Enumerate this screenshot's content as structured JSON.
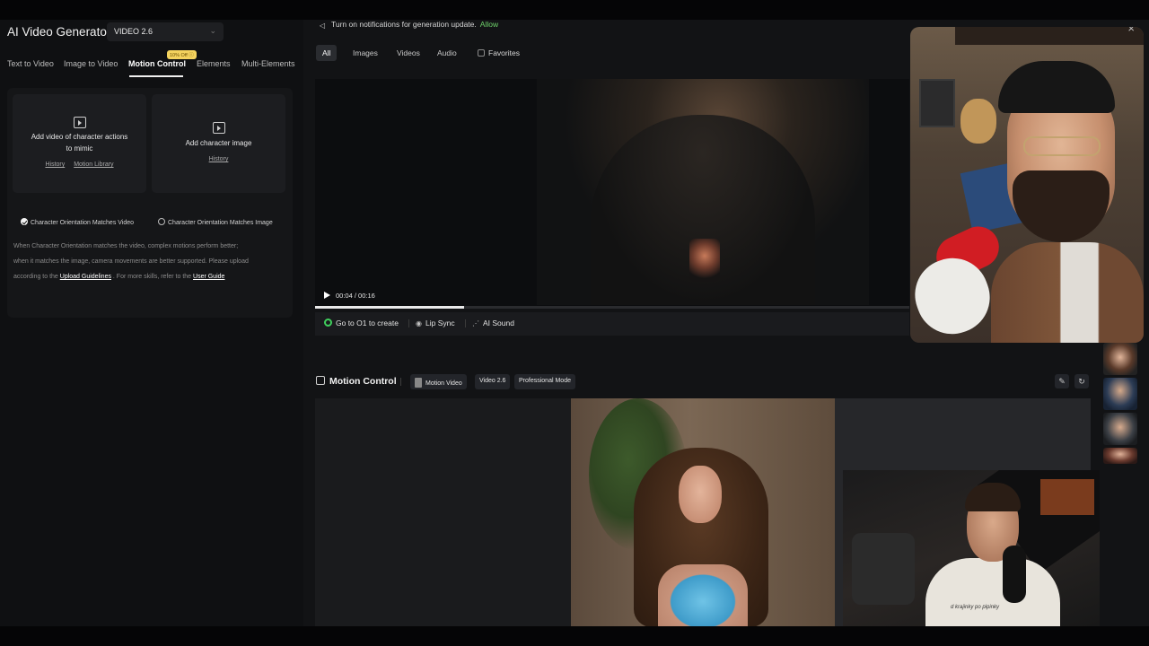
{
  "app": {
    "title": "AI Video Generator",
    "model_select": "VIDEO 2.6"
  },
  "tabs": [
    {
      "label": "Text to Video"
    },
    {
      "label": "Image to Video"
    },
    {
      "label": "Motion Control"
    },
    {
      "label": "Elements"
    },
    {
      "label": "Multi-Elements"
    }
  ],
  "promo_badge": "10% Off ⓘ",
  "upload": {
    "video_card": {
      "title_line1": "Add video of character actions",
      "title_line2": "to mimic",
      "link_history": "History",
      "link_library": "Motion Library"
    },
    "image_card": {
      "title": "Add character image",
      "link_history": "History"
    },
    "orientation_video": "Character Orientation Matches Video",
    "orientation_image": "Character Orientation Matches Image",
    "help_line1": "When Character Orientation matches the video, complex motions perform better;",
    "help_line2": "when it matches the image, camera movements are better supported. Please upload",
    "help_prefix": "according to the",
    "help_link1": "Upload Guidelines",
    "help_middle": ". For more skills, refer to the",
    "help_link2": "User Guide"
  },
  "notification": {
    "text": "Turn on notifications for generation update.",
    "allow": "Allow"
  },
  "filters": [
    {
      "label": "All",
      "active": true
    },
    {
      "label": "Images",
      "active": false
    },
    {
      "label": "Videos",
      "active": false
    },
    {
      "label": "Audio",
      "active": false
    }
  ],
  "favorites": "Favorites",
  "player": {
    "time": "00:04 / 00:16",
    "progress": 0.25
  },
  "actions": {
    "go_o1": "Go to O1 to create",
    "lip_sync": "Lip Sync",
    "ai_sound": "AI Sound"
  },
  "motion_control": {
    "title": "Motion Control",
    "tag_motion_video": "Motion Video",
    "tag_version": "Video 2.6",
    "tag_mode": "Professional Mode"
  },
  "cam2_shirt_text": "d krajinky po pipinky",
  "colors": {
    "accent_green": "#6fd36b",
    "promo_yellow": "#f4d35e"
  },
  "icons": {
    "speaker": "speaker-icon",
    "close": "close-icon",
    "play": "play-icon",
    "edit": "edit-icon",
    "refresh": "refresh-icon"
  }
}
